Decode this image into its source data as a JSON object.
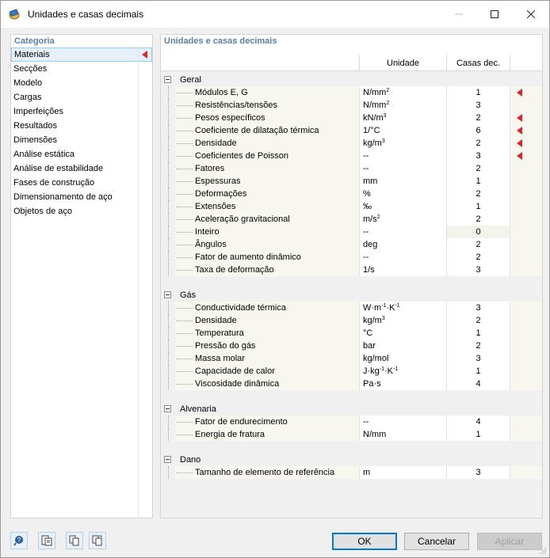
{
  "window": {
    "title": "Unidades e casas decimais"
  },
  "left": {
    "header": "Categoria",
    "items": [
      "Materiais",
      "Secções",
      "Modelo",
      "Cargas",
      "Imperfeições",
      "Resultados",
      "Dimensões",
      "Análise estática",
      "Análise de estabilidade",
      "Fases de construção",
      "Dimensionamento de aço",
      "Objetos de aço"
    ],
    "selected": "Materiais"
  },
  "right": {
    "header": "Unidades e casas decimais",
    "columns": {
      "unit": "Unidade",
      "decimals": "Casas dec."
    },
    "groups": [
      {
        "name": "Geral",
        "rows": [
          {
            "name": "Módulos E, G",
            "unit_base": "N/mm",
            "unit_sup": "2",
            "dec": "1",
            "flag": true
          },
          {
            "name": "Resistências/tensões",
            "unit_base": "N/mm",
            "unit_sup": "2",
            "dec": "3",
            "flag": false
          },
          {
            "name": "Pesos específicos",
            "unit_base": "kN/m",
            "unit_sup": "3",
            "dec": "2",
            "flag": true
          },
          {
            "name": "Coeficiente de dilatação térmica",
            "unit_base": "1/°C",
            "unit_sup": "",
            "dec": "6",
            "flag": true
          },
          {
            "name": "Densidade",
            "unit_base": "kg/m",
            "unit_sup": "3",
            "dec": "2",
            "flag": true
          },
          {
            "name": "Coeficientes de Poisson",
            "unit_base": "--",
            "unit_sup": "",
            "dec": "3",
            "flag": true
          },
          {
            "name": "Fatores",
            "unit_base": "--",
            "unit_sup": "",
            "dec": "2",
            "flag": false
          },
          {
            "name": "Espessuras",
            "unit_base": "mm",
            "unit_sup": "",
            "dec": "1",
            "flag": false
          },
          {
            "name": "Deformações",
            "unit_base": "%",
            "unit_sup": "",
            "dec": "2",
            "flag": false
          },
          {
            "name": "Extensões",
            "unit_base": "‰",
            "unit_sup": "",
            "dec": "1",
            "flag": false
          },
          {
            "name": "Aceleração gravitacional",
            "unit_base": "m/s",
            "unit_sup": "2",
            "dec": "2",
            "flag": false
          },
          {
            "name": "Inteiro",
            "unit_base": "--",
            "unit_sup": "",
            "dec": "0",
            "flag": false,
            "disabled": true
          },
          {
            "name": "Ângulos",
            "unit_base": "deg",
            "unit_sup": "",
            "dec": "2",
            "flag": false
          },
          {
            "name": "Fator de aumento dinâmico",
            "unit_base": "--",
            "unit_sup": "",
            "dec": "2",
            "flag": false
          },
          {
            "name": "Taxa de deformação",
            "unit_base": "1/s",
            "unit_sup": "",
            "dec": "3",
            "flag": false
          }
        ]
      },
      {
        "name": "Gás",
        "rows": [
          {
            "name": "Conductividade térmica",
            "unit_html": "W·m<sup>-1</sup>·K<sup>-1</sup>",
            "dec": "3",
            "flag": false
          },
          {
            "name": "Densidade",
            "unit_base": "kg/m",
            "unit_sup": "3",
            "dec": "2",
            "flag": false
          },
          {
            "name": "Temperatura",
            "unit_base": "°C",
            "unit_sup": "",
            "dec": "1",
            "flag": false
          },
          {
            "name": "Pressão do gás",
            "unit_base": "bar",
            "unit_sup": "",
            "dec": "2",
            "flag": false
          },
          {
            "name": "Massa molar",
            "unit_base": "kg/mol",
            "unit_sup": "",
            "dec": "3",
            "flag": false
          },
          {
            "name": "Capacidade de calor",
            "unit_html": "J·kg<sup>-1</sup>·K<sup>-1</sup>",
            "dec": "1",
            "flag": false
          },
          {
            "name": "Viscosidade dinâmica",
            "unit_base": "Pa·s",
            "unit_sup": "",
            "dec": "4",
            "flag": false
          }
        ]
      },
      {
        "name": "Alvenaria",
        "rows": [
          {
            "name": "Fator de endurecimento",
            "unit_base": "--",
            "unit_sup": "",
            "dec": "4",
            "flag": false
          },
          {
            "name": "Energia de fratura",
            "unit_base": "N/mm",
            "unit_sup": "",
            "dec": "1",
            "flag": false
          }
        ]
      },
      {
        "name": "Dano",
        "rows": [
          {
            "name": "Tamanho de elemento de referência",
            "unit_base": "m",
            "unit_sup": "",
            "dec": "3",
            "flag": false
          }
        ]
      }
    ]
  },
  "footer": {
    "icons": [
      "help-icon",
      "units-table-icon",
      "copy-settings-icon",
      "paste-settings-icon"
    ],
    "ok": "OK",
    "cancel": "Cancelar",
    "apply": "Aplicar"
  },
  "colors": {
    "marker": "#d9262c",
    "header": "#5b7fa6",
    "selection": "#e5f0fb",
    "ok_border": "#0078d7"
  }
}
